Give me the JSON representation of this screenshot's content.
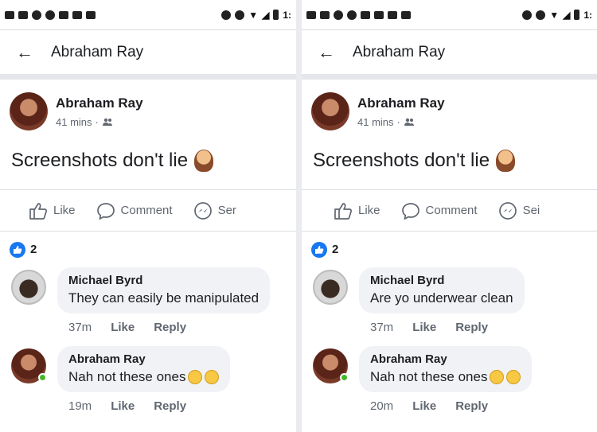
{
  "status_bar": {
    "time_left": "1:",
    "time_right": "1:"
  },
  "panels": [
    {
      "header": {
        "title": "Abraham Ray"
      },
      "post": {
        "author": "Abraham Ray",
        "time": "41 mins",
        "text": "Screenshots don't lie"
      },
      "actions": {
        "like": "Like",
        "comment": "Comment",
        "share": "Ser"
      },
      "reactions": {
        "count": "2"
      },
      "comments": [
        {
          "author": "Michael Byrd",
          "text": "They can easily be manipulated",
          "time": "37m",
          "like": "Like",
          "reply": "Reply"
        },
        {
          "author": "Abraham Ray",
          "text": "Nah not these ones",
          "time": "19m",
          "like": "Like",
          "reply": "Reply"
        }
      ]
    },
    {
      "header": {
        "title": "Abraham Ray"
      },
      "post": {
        "author": "Abraham Ray",
        "time": "41 mins",
        "text": "Screenshots don't lie"
      },
      "actions": {
        "like": "Like",
        "comment": "Comment",
        "share": "Sei"
      },
      "reactions": {
        "count": "2"
      },
      "comments": [
        {
          "author": "Michael Byrd",
          "text": "Are yo underwear clean",
          "time": "37m",
          "like": "Like",
          "reply": "Reply"
        },
        {
          "author": "Abraham Ray",
          "text": "Nah not these ones",
          "time": "20m",
          "like": "Like",
          "reply": "Reply"
        }
      ]
    }
  ]
}
